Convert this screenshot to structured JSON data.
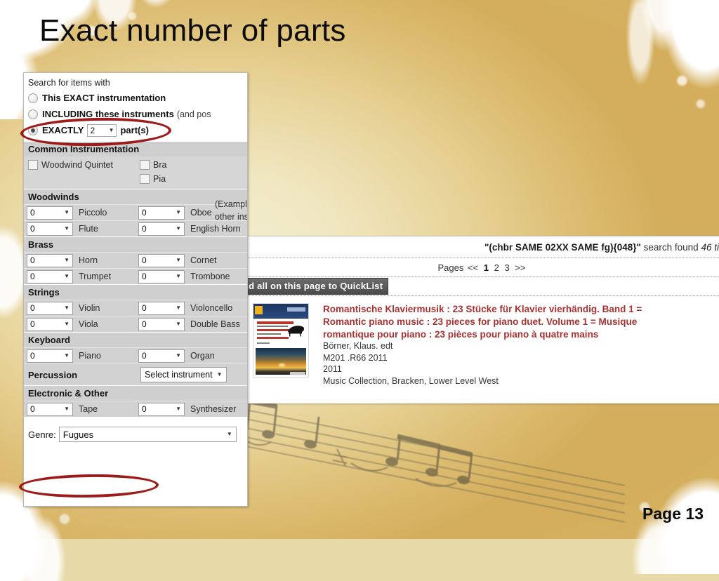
{
  "slide": {
    "title": "Exact number of parts",
    "page_number": "Page 13"
  },
  "form": {
    "search_legend": "Search for items with",
    "options": [
      {
        "label": "This EXACT instrumentation",
        "note": "",
        "selected": false
      },
      {
        "label": "INCLUDING these instruments",
        "note": "(and pos",
        "selected": false
      },
      {
        "label": "EXACTLY",
        "suffix": "part(s)",
        "value": "2",
        "selected": true
      }
    ],
    "example_note_line1": "(Example:",
    "example_note_line2": "other instru",
    "common_heading": "Common Instrumentation",
    "common_checkboxes_left": [
      "Woodwind Quintet"
    ],
    "common_checkboxes_right": [
      "Bra",
      "Pia"
    ],
    "sections": [
      {
        "heading": "Woodwinds",
        "rows": [
          {
            "left": {
              "count": "0",
              "name": "Piccolo"
            },
            "right": {
              "count": "0",
              "name": "Oboe"
            }
          },
          {
            "left": {
              "count": "0",
              "name": "Flute"
            },
            "right": {
              "count": "0",
              "name": "English Horn"
            }
          }
        ]
      },
      {
        "heading": "Brass",
        "rows": [
          {
            "left": {
              "count": "0",
              "name": "Horn"
            },
            "right": {
              "count": "0",
              "name": "Cornet"
            }
          },
          {
            "left": {
              "count": "0",
              "name": "Trumpet"
            },
            "right": {
              "count": "0",
              "name": "Trombone"
            }
          }
        ]
      },
      {
        "heading": "Strings",
        "rows": [
          {
            "left": {
              "count": "0",
              "name": "Violin"
            },
            "right": {
              "count": "0",
              "name": "Violoncello"
            }
          },
          {
            "left": {
              "count": "0",
              "name": "Viola"
            },
            "right": {
              "count": "0",
              "name": "Double Bass"
            }
          }
        ]
      },
      {
        "heading": "Keyboard",
        "rows": [
          {
            "left": {
              "count": "0",
              "name": "Piano"
            },
            "right": {
              "count": "0",
              "name": "Organ"
            }
          }
        ]
      }
    ],
    "percussion": {
      "heading": "Percussion",
      "select_value": "Select instrument"
    },
    "electronic": {
      "heading": "Electronic & Other",
      "rows": [
        {
          "left": {
            "count": "0",
            "name": "Tape"
          },
          "right": {
            "count": "0",
            "name": "Synthesizer"
          }
        }
      ]
    },
    "genre": {
      "label": "Genre:",
      "value": "Fugues"
    }
  },
  "results": {
    "query": "\"(chbr SAME 02XX SAME fg){048}\"",
    "found_text": "search found",
    "count_text": "46 ti",
    "pager_label": "Pages",
    "pager_prev": "<<",
    "pager_pages": [
      "1",
      "2",
      "3"
    ],
    "pager_current": "1",
    "pager_next": ">>",
    "quicklist_button": "dd all on this page to QuickList",
    "record": {
      "title_line1": "Romantische Klaviermusik : 23 Stücke für Klavier vierhändig. Band 1 =",
      "title_line2": "Romantic piano music : 23 pieces for piano duet. Volume 1 = Musique",
      "title_line3": "romantique pour piano : 23 pièces pour piano à quatre mains",
      "author": "Börner, Klaus. edt",
      "call_number": "M201 .R66 2011",
      "year": "2011",
      "location": "Music Collection, Bracken, Lower Level West"
    }
  },
  "colors": {
    "annotation": "#9e1b1b",
    "record_title": "#a83232",
    "background_gold": "#ddbe74"
  }
}
